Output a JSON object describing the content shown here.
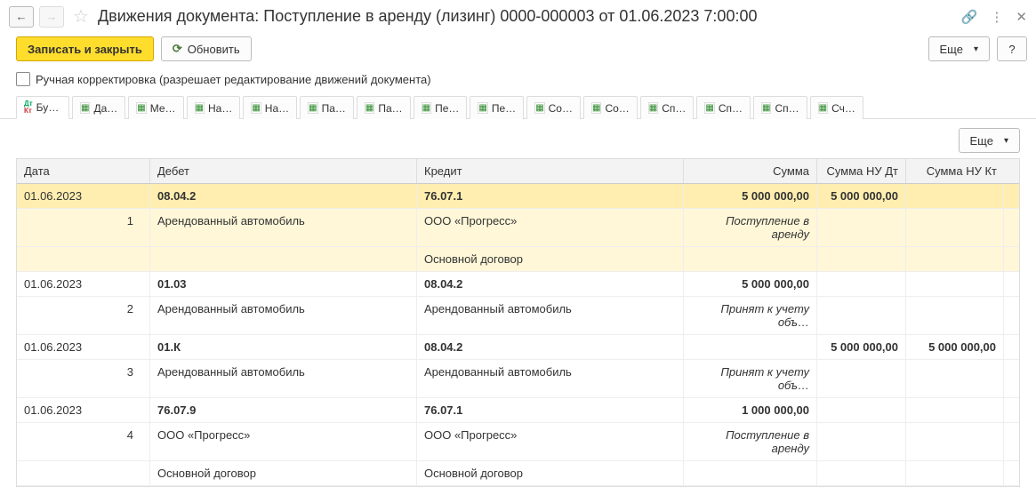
{
  "window": {
    "title": "Движения документа: Поступление в аренду (лизинг) 0000-000003 от 01.06.2023 7:00:00"
  },
  "toolbar": {
    "save_close": "Записать и закрыть",
    "refresh": "Обновить",
    "more": "Еще",
    "help": "?"
  },
  "manual_check": {
    "label": "Ручная корректировка (разрешает редактирование движений документа)"
  },
  "tabs": [
    {
      "label": "Бу…"
    },
    {
      "label": "Да…"
    },
    {
      "label": "Ме…"
    },
    {
      "label": "На…"
    },
    {
      "label": "На…"
    },
    {
      "label": "Па…"
    },
    {
      "label": "Па…"
    },
    {
      "label": "Пе…"
    },
    {
      "label": "Пе…"
    },
    {
      "label": "Со…"
    },
    {
      "label": "Со…"
    },
    {
      "label": "Сп…"
    },
    {
      "label": "Сп…"
    },
    {
      "label": "Сп…"
    },
    {
      "label": "Сч…"
    }
  ],
  "content_toolbar": {
    "more": "Еще"
  },
  "grid": {
    "headers": {
      "date": "Дата",
      "debit": "Дебет",
      "credit": "Кредит",
      "sum": "Сумма",
      "nud": "Сумма НУ Дт",
      "nuk": "Сумма НУ Кт"
    },
    "entries": [
      {
        "highlight": true,
        "date": "01.06.2023",
        "idx": "1",
        "debit_top": "08.04.2",
        "debit_sub1": "Арендованный автомобиль",
        "debit_sub2": "",
        "credit_top": "76.07.1",
        "credit_sub1": "ООО «Прогресс»",
        "credit_sub2": "Основной договор",
        "sum": "5 000 000,00",
        "sum_note": "Поступление в аренду",
        "nud": "5 000 000,00",
        "nuk": ""
      },
      {
        "highlight": false,
        "date": "01.06.2023",
        "idx": "2",
        "debit_top": "01.03",
        "debit_sub1": "Арендованный автомобиль",
        "debit_sub2": "",
        "credit_top": "08.04.2",
        "credit_sub1": "Арендованный автомобиль",
        "credit_sub2": "",
        "sum": "5 000 000,00",
        "sum_note": "Принят к учету объ…",
        "nud": "",
        "nuk": ""
      },
      {
        "highlight": false,
        "date": "01.06.2023",
        "idx": "3",
        "debit_top": "01.К",
        "debit_sub1": "Арендованный автомобиль",
        "debit_sub2": "",
        "credit_top": "08.04.2",
        "credit_sub1": "Арендованный автомобиль",
        "credit_sub2": "",
        "sum": "",
        "sum_note": "Принят к учету объ…",
        "nud": "5 000 000,00",
        "nuk": "5 000 000,00"
      },
      {
        "highlight": false,
        "date": "01.06.2023",
        "idx": "4",
        "debit_top": "76.07.9",
        "debit_sub1": "ООО «Прогресс»",
        "debit_sub2": "Основной договор",
        "credit_top": "76.07.1",
        "credit_sub1": "ООО «Прогресс»",
        "credit_sub2": "Основной договор",
        "sum": "1 000 000,00",
        "sum_note": "Поступление в аренду",
        "nud": "",
        "nuk": ""
      }
    ]
  }
}
